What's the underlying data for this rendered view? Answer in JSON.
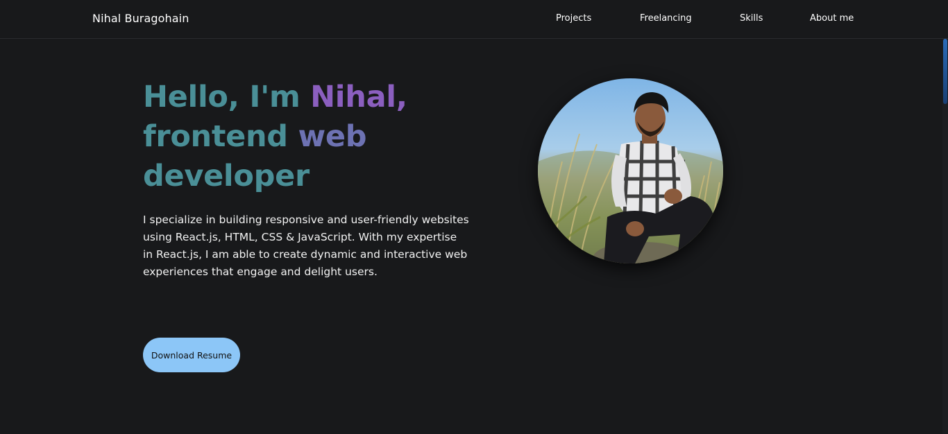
{
  "header": {
    "brand": "Nihal Buragohain",
    "nav": [
      {
        "label": "Projects"
      },
      {
        "label": "Freelancing"
      },
      {
        "label": "Skills"
      },
      {
        "label": "About me"
      }
    ]
  },
  "hero": {
    "title_line1_a": "Hello, I'm ",
    "title_line1_b": "Nihal,",
    "title_line2_a": "frontend ",
    "title_line2_b": "web",
    "title_line3": "developer",
    "description": "I specialize in building responsive and user-friendly websites using React.js, HTML, CSS & JavaScript. With my expertise in React.js, I am able to create dynamic and interactive web experiences that engage and delight users.",
    "button_label": "Download Resume"
  },
  "colors": {
    "background": "#18191b",
    "teal": "#4a8f97",
    "violet": "#8b5fbf",
    "button": "#8cc6f7"
  }
}
